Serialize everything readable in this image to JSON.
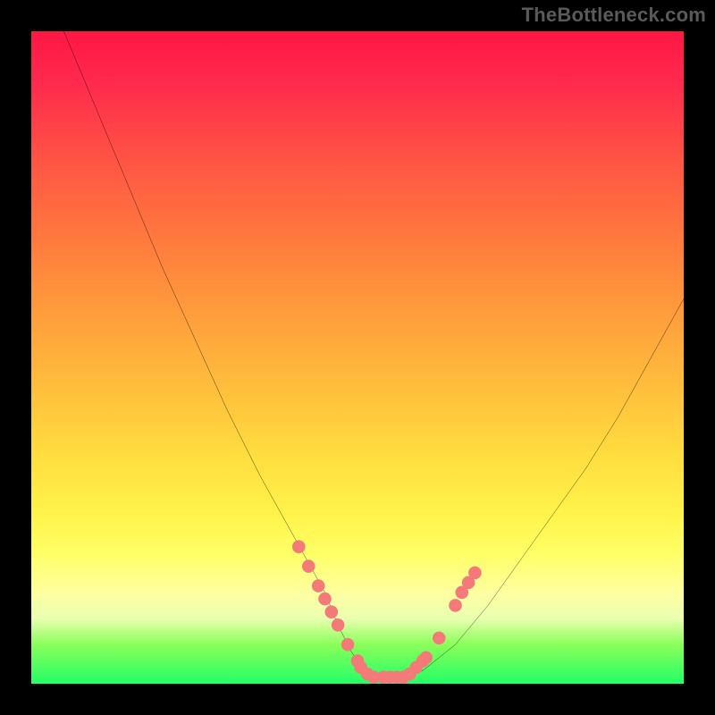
{
  "watermark": "TheBottleneck.com",
  "chart_data": {
    "type": "line",
    "title": "",
    "xlabel": "",
    "ylabel": "",
    "xlim": [
      0,
      100
    ],
    "ylim": [
      0,
      100
    ],
    "grid": false,
    "legend": false,
    "series": [
      {
        "name": "bottleneck-curve",
        "color": "#000000",
        "x": [
          5,
          10,
          15,
          20,
          25,
          30,
          35,
          40,
          45,
          47,
          49,
          51,
          53,
          55,
          57,
          60,
          65,
          70,
          75,
          80,
          85,
          90,
          95,
          100
        ],
        "values": [
          100,
          88,
          76,
          64,
          53,
          42,
          32,
          23,
          14,
          9,
          5,
          2,
          1,
          1,
          1,
          2,
          6,
          12,
          19,
          26,
          33,
          41,
          50,
          59
        ]
      }
    ],
    "markers": {
      "name": "highlight-points",
      "color": "#f47a7a",
      "shape": "circle",
      "points": [
        {
          "x": 41,
          "y": 21
        },
        {
          "x": 42.5,
          "y": 18
        },
        {
          "x": 44,
          "y": 15
        },
        {
          "x": 45,
          "y": 13
        },
        {
          "x": 46,
          "y": 11
        },
        {
          "x": 47,
          "y": 9
        },
        {
          "x": 48.5,
          "y": 6
        },
        {
          "x": 50,
          "y": 3.5
        },
        {
          "x": 50.5,
          "y": 2.5
        },
        {
          "x": 51.5,
          "y": 1.5
        },
        {
          "x": 52.5,
          "y": 1
        },
        {
          "x": 54,
          "y": 1
        },
        {
          "x": 55,
          "y": 1
        },
        {
          "x": 56,
          "y": 1
        },
        {
          "x": 57,
          "y": 1
        },
        {
          "x": 58,
          "y": 1.5
        },
        {
          "x": 59,
          "y": 2.5
        },
        {
          "x": 60,
          "y": 3.5
        },
        {
          "x": 60.5,
          "y": 4
        },
        {
          "x": 62.5,
          "y": 7
        },
        {
          "x": 65,
          "y": 12
        },
        {
          "x": 66,
          "y": 14
        },
        {
          "x": 67,
          "y": 15.5
        },
        {
          "x": 68,
          "y": 17
        }
      ]
    },
    "background_gradient": {
      "direction": "vertical",
      "stops": [
        {
          "pos": 0,
          "color": "#ff1744"
        },
        {
          "pos": 33,
          "color": "#ff7d3d"
        },
        {
          "pos": 65,
          "color": "#ffdd3f"
        },
        {
          "pos": 86,
          "color": "#ffffa0"
        },
        {
          "pos": 100,
          "color": "#22ff66"
        }
      ]
    }
  }
}
